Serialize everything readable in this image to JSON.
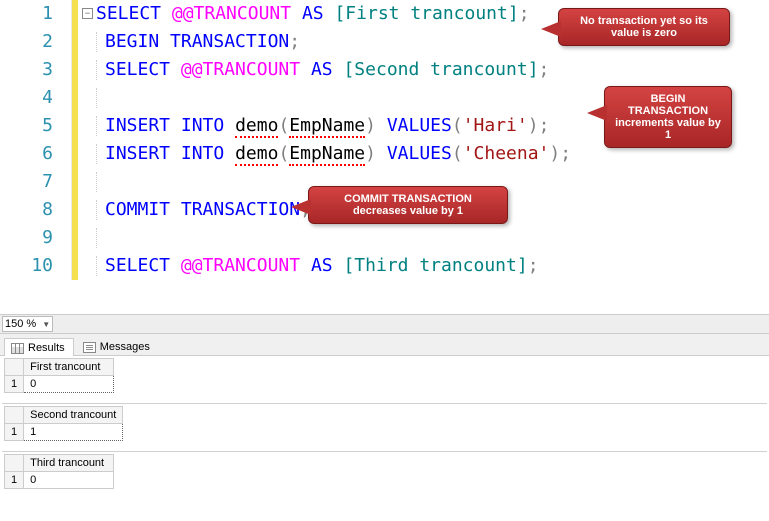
{
  "editor": {
    "lines": [
      1,
      2,
      3,
      4,
      5,
      6,
      7,
      8,
      9,
      10
    ],
    "code": {
      "l1_kw": "SELECT",
      "l1_func": "@@TRANCOUNT",
      "l1_as": "AS",
      "l1_alias": "[First trancount]",
      "l1_semi": ";",
      "l2_kw1": "BEGIN",
      "l2_kw2": "TRANSACTION",
      "l2_semi": ";",
      "l3_kw": "SELECT",
      "l3_func": "@@TRANCOUNT",
      "l3_as": "AS",
      "l3_alias": "[Second trancount]",
      "l3_semi": ";",
      "l5_kw1": "INSERT",
      "l5_kw2": "INTO",
      "l5_tbl": "demo",
      "l5_open": "(",
      "l5_col": "EmpName",
      "l5_close": ")",
      "l5_kw3": "VALUES",
      "l5_open2": "(",
      "l5_str": "'Hari'",
      "l5_close2": ")",
      "l5_semi": ";",
      "l6_kw1": "INSERT",
      "l6_kw2": "INTO",
      "l6_tbl": "demo",
      "l6_open": "(",
      "l6_col": "EmpName",
      "l6_close": ")",
      "l6_kw3": "VALUES",
      "l6_open2": "(",
      "l6_str": "'Cheena'",
      "l6_close2": ")",
      "l6_semi": ";",
      "l8_kw1": "COMMIT",
      "l8_kw2": "TRANSACTION",
      "l8_semi": ";",
      "l10_kw": "SELECT",
      "l10_func": "@@TRANCOUNT",
      "l10_as": "AS",
      "l10_alias": "[Third trancount]",
      "l10_semi": ";"
    }
  },
  "callouts": {
    "c1": "No transaction yet so its value is zero",
    "c2": "BEGIN TRANSACTION increments value by 1",
    "c3": "COMMIT TRANSACTION decreases value by 1"
  },
  "zoom": {
    "value": "150 %"
  },
  "tabs": {
    "results": "Results",
    "messages": "Messages"
  },
  "results": {
    "r1": {
      "header": "First trancount",
      "rownum": "1",
      "value": "0"
    },
    "r2": {
      "header": "Second trancount",
      "rownum": "1",
      "value": "1"
    },
    "r3": {
      "header": "Third trancount",
      "rownum": "1",
      "value": "0"
    }
  },
  "fold_symbol": "−"
}
